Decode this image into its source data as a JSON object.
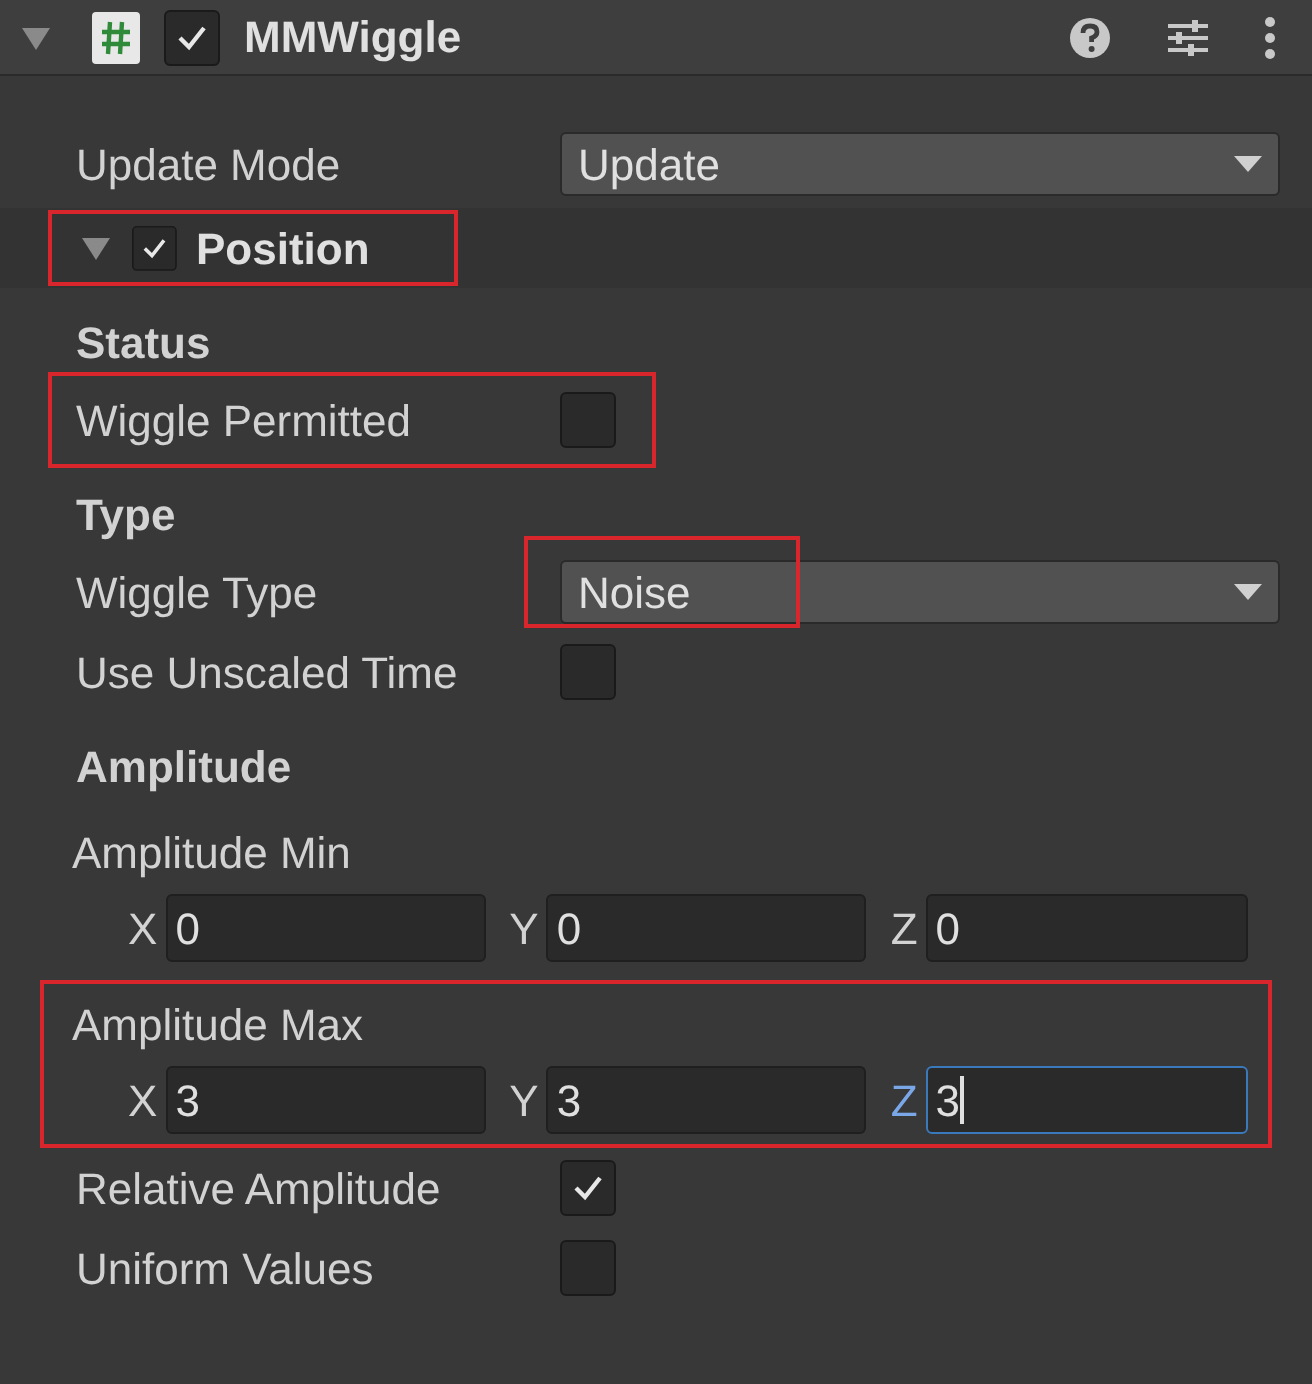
{
  "component": {
    "title": "MMWiggle",
    "enabled": true,
    "expanded": true
  },
  "fields": [
    {
      "kind": "dropdown",
      "label": "Update Mode",
      "value": "Update",
      "highlighted": false
    },
    {
      "kind": "foldout",
      "label": "Position",
      "expanded": true,
      "checked": true,
      "highlighted": true
    },
    {
      "kind": "heading",
      "label": "Status"
    },
    {
      "kind": "checkbox",
      "label": "Wiggle Permitted",
      "checked": false,
      "highlighted": true
    },
    {
      "kind": "heading",
      "label": "Type"
    },
    {
      "kind": "dropdown",
      "label": "Wiggle Type",
      "value": "Noise",
      "highlighted": true
    },
    {
      "kind": "checkbox",
      "label": "Use Unscaled Time",
      "checked": false,
      "highlighted": false
    },
    {
      "kind": "heading",
      "label": "Amplitude"
    },
    {
      "kind": "vector",
      "label": "Amplitude Min",
      "highlighted": false,
      "components": [
        {
          "label": "X",
          "value": "0",
          "focused": false
        },
        {
          "label": "Y",
          "value": "0",
          "focused": false
        },
        {
          "label": "Z",
          "value": "0",
          "focused": false
        }
      ]
    },
    {
      "kind": "vector",
      "label": "Amplitude Max",
      "highlighted": true,
      "components": [
        {
          "label": "X",
          "value": "3",
          "focused": false
        },
        {
          "label": "Y",
          "value": "3",
          "focused": false
        },
        {
          "label": "Z",
          "value": "3",
          "focused": true
        }
      ]
    },
    {
      "kind": "checkbox",
      "label": "Relative Amplitude",
      "checked": true,
      "highlighted": false
    },
    {
      "kind": "checkbox",
      "label": "Uniform Values",
      "checked": false,
      "highlighted": false
    }
  ]
}
